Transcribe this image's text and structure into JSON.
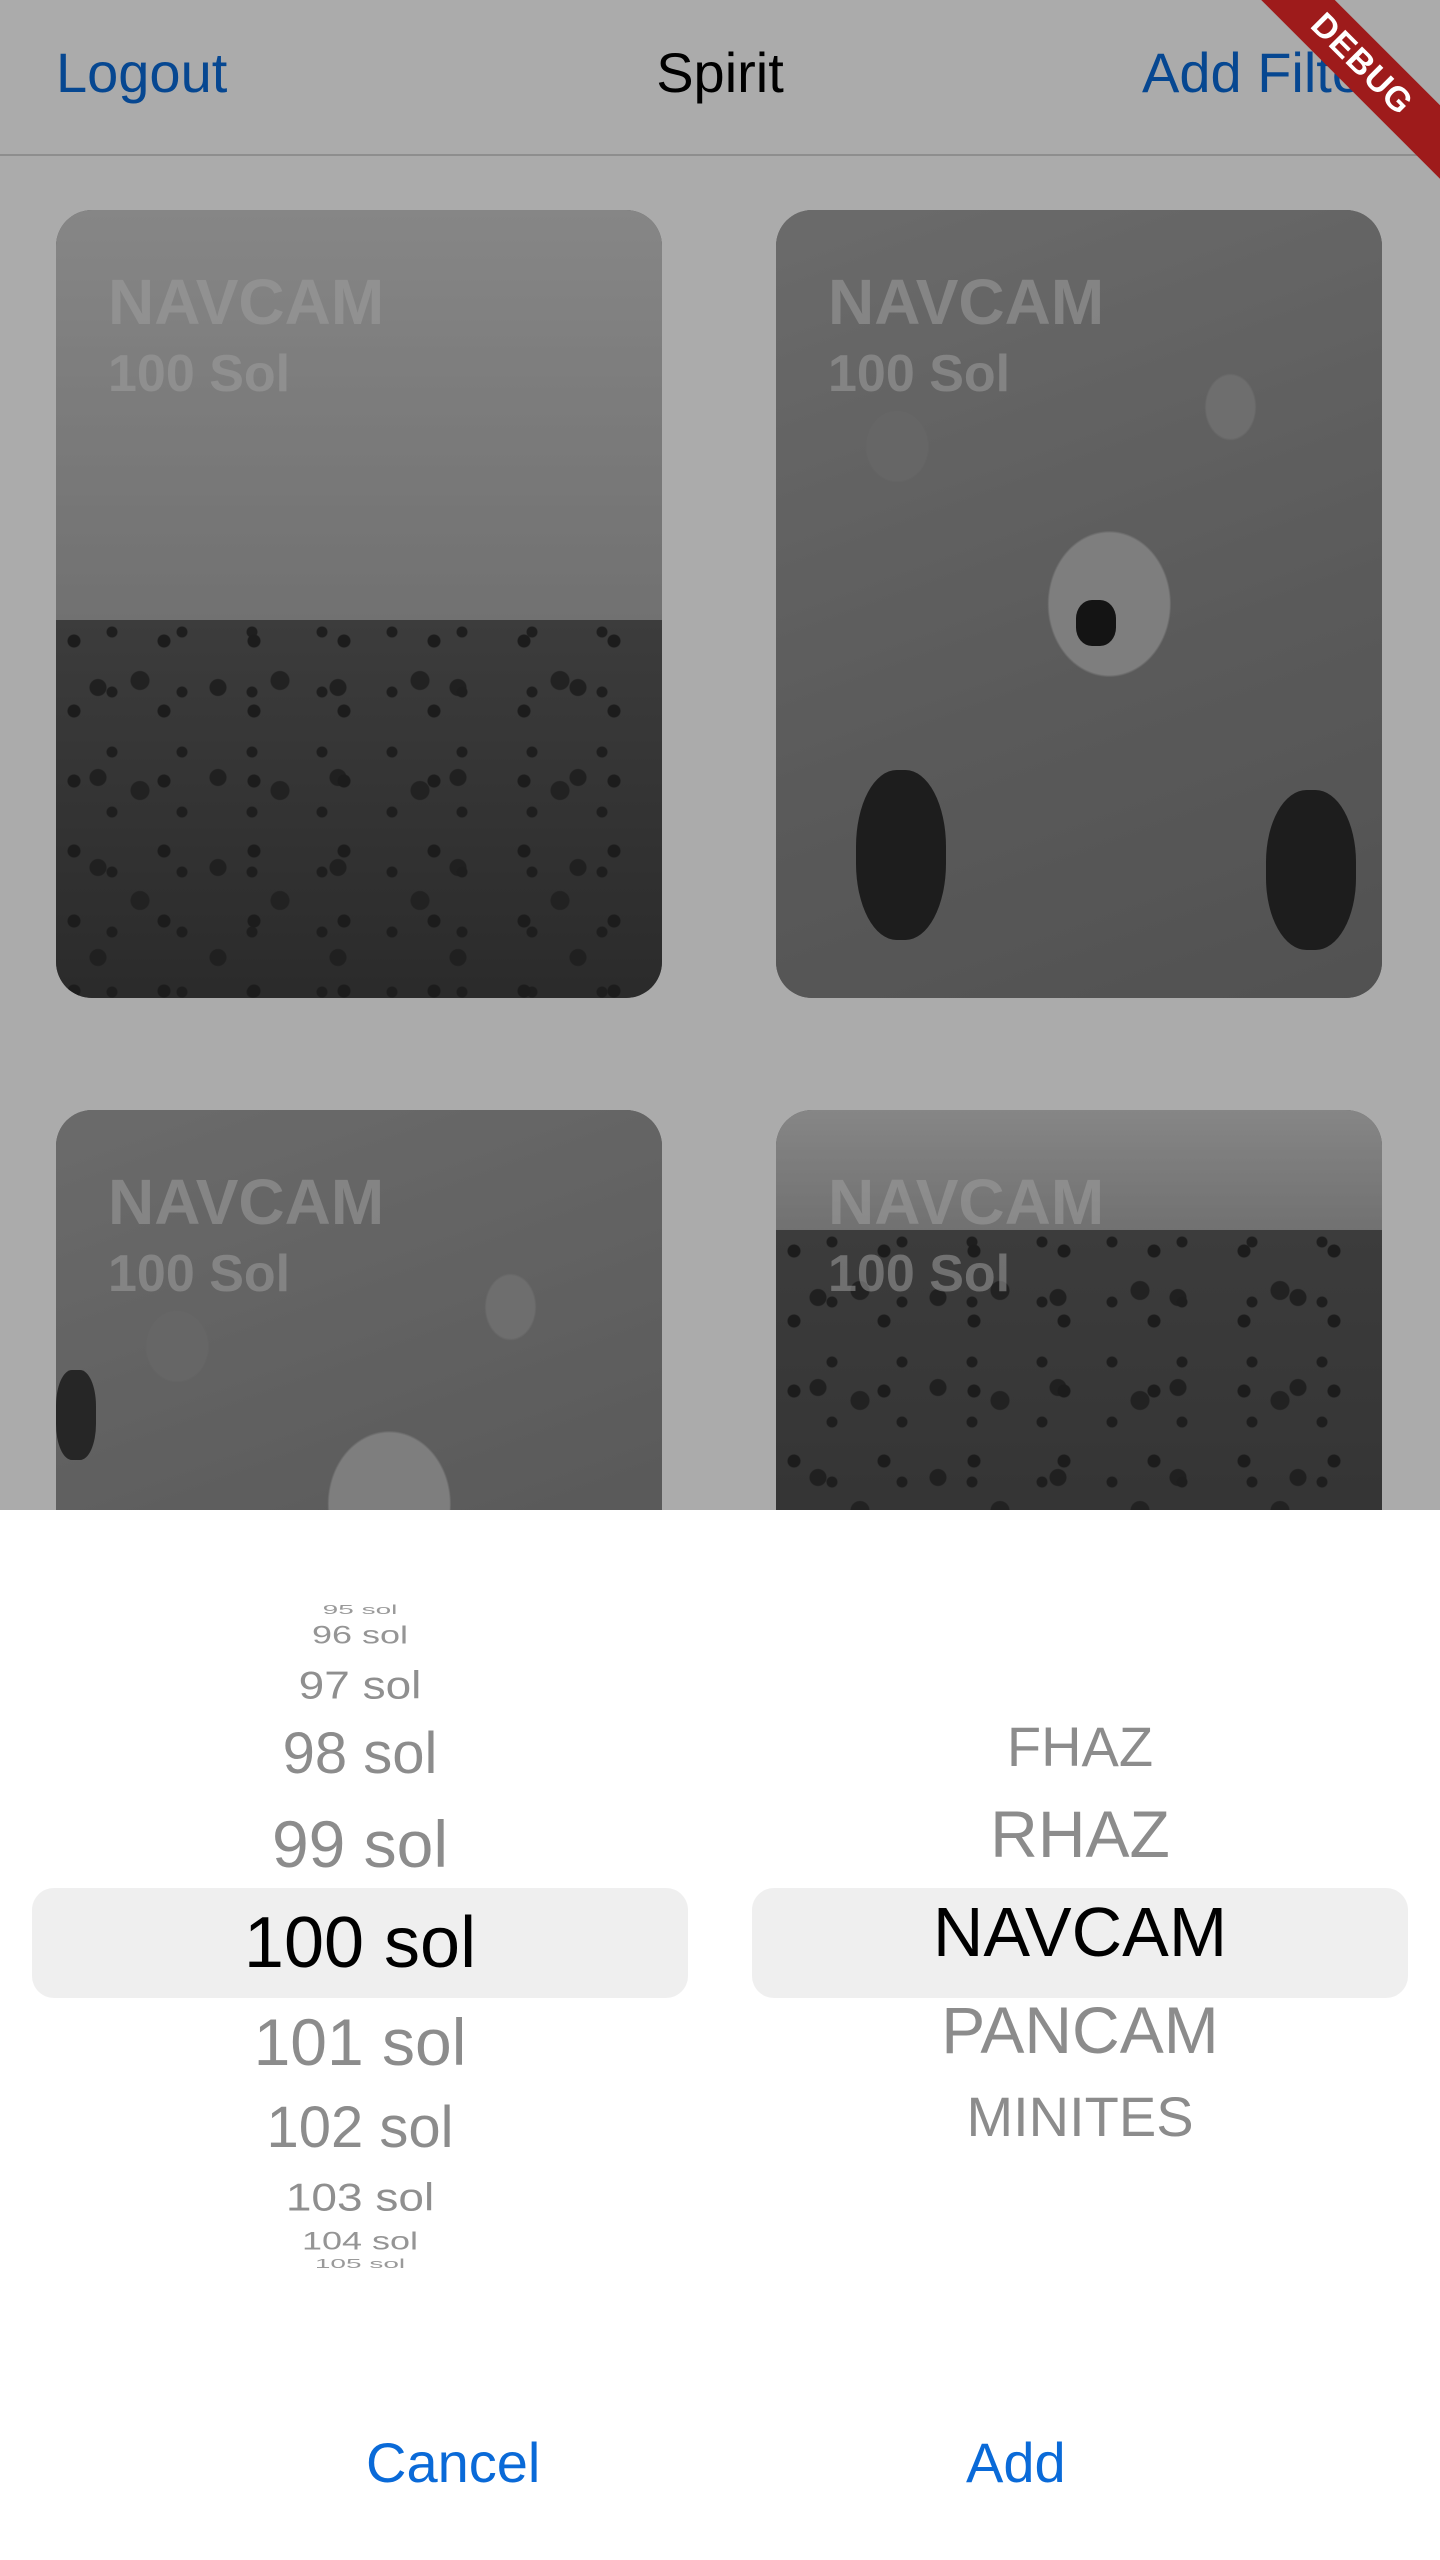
{
  "appbar": {
    "logout_label": "Logout",
    "title": "Spirit",
    "add_filter_label": "Add Filter"
  },
  "debug_banner": "DEBUG",
  "cards": [
    {
      "camera": "NAVCAM",
      "sol": "100 Sol"
    },
    {
      "camera": "NAVCAM",
      "sol": "100 Sol"
    },
    {
      "camera": "NAVCAM",
      "sol": "100 Sol"
    },
    {
      "camera": "NAVCAM",
      "sol": "100 Sol"
    }
  ],
  "sol_picker": {
    "items": [
      "95 sol",
      "96 sol",
      "97 sol",
      "98 sol",
      "99 sol",
      "100 sol",
      "101 sol",
      "102 sol",
      "103 sol",
      "104 sol",
      "105 sol"
    ],
    "selected": "100 sol"
  },
  "camera_picker": {
    "items": [
      "FHAZ",
      "RHAZ",
      "NAVCAM",
      "PANCAM",
      "MINITES"
    ],
    "selected": "NAVCAM"
  },
  "actions": {
    "cancel_label": "Cancel",
    "add_label": "Add"
  },
  "colors": {
    "accent": "#0a6ad8",
    "debug": "#9e1b1b"
  }
}
